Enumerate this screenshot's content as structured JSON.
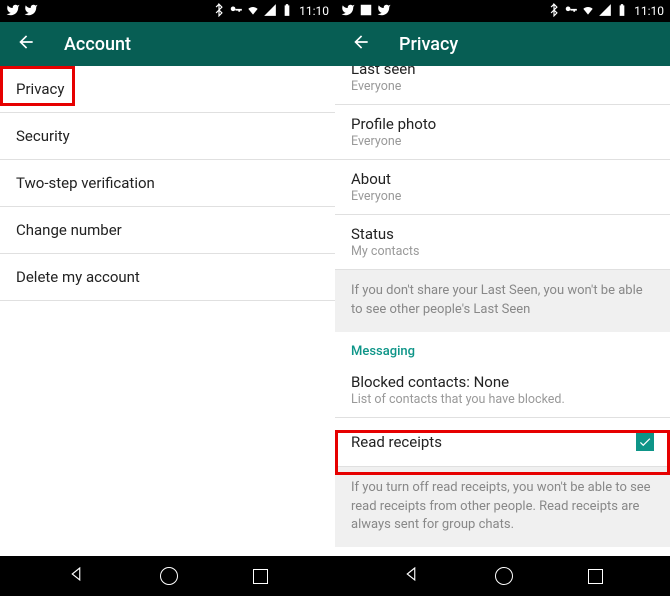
{
  "status": {
    "time": "11:10"
  },
  "left": {
    "title": "Account",
    "items": [
      "Privacy",
      "Security",
      "Two-step verification",
      "Change number",
      "Delete my account"
    ]
  },
  "right": {
    "title": "Privacy",
    "last_seen": {
      "title": "Last seen",
      "value": "Everyone"
    },
    "profile_photo": {
      "title": "Profile photo",
      "value": "Everyone"
    },
    "about": {
      "title": "About",
      "value": "Everyone"
    },
    "status": {
      "title": "Status",
      "value": "My contacts"
    },
    "last_seen_info": "If you don't share your Last Seen, you won't be able to see other people's Last Seen",
    "messaging_header": "Messaging",
    "blocked": {
      "title": "Blocked contacts: None",
      "sub": "List of contacts that you have blocked."
    },
    "read_receipts": {
      "title": "Read receipts",
      "checked": true
    },
    "read_receipts_info": "If you turn off read receipts, you won't be able to see read receipts from other people. Read receipts are always sent for group chats."
  }
}
